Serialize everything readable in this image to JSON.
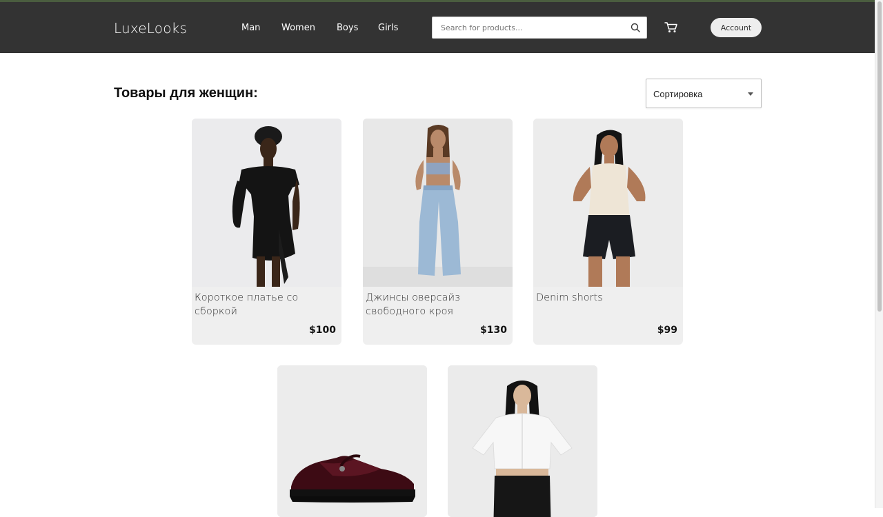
{
  "header": {
    "logo": "LuxeLooks",
    "nav": [
      "Man",
      "Women",
      "Boys",
      "Girls"
    ],
    "search_placeholder": "Search for products...",
    "account_label": "Account"
  },
  "main": {
    "title": "Товары для женщин:",
    "sort_label": "Сортировка",
    "products": [
      {
        "name": "Короткое платье со сборкой",
        "price": "$100",
        "image": "black off-shoulder dress"
      },
      {
        "name": "Джинсы оверсайз свободного кроя",
        "price": "$130",
        "image": "oversize light blue jeans"
      },
      {
        "name": "Denim shorts",
        "price": "$99",
        "image": "black denim shorts with white tank top"
      },
      {
        "name": "",
        "price": "",
        "image": "burgundy patent mary-jane shoe"
      },
      {
        "name": "",
        "price": "",
        "image": "white cropped shirt"
      }
    ]
  },
  "colors": {
    "header_bg": "#333333",
    "header_accent": "#4a5d3f",
    "card_bg": "#efefef",
    "text_dark": "#111111"
  },
  "icons": [
    "search-icon",
    "cart-icon",
    "dropdown-caret-icon"
  ]
}
